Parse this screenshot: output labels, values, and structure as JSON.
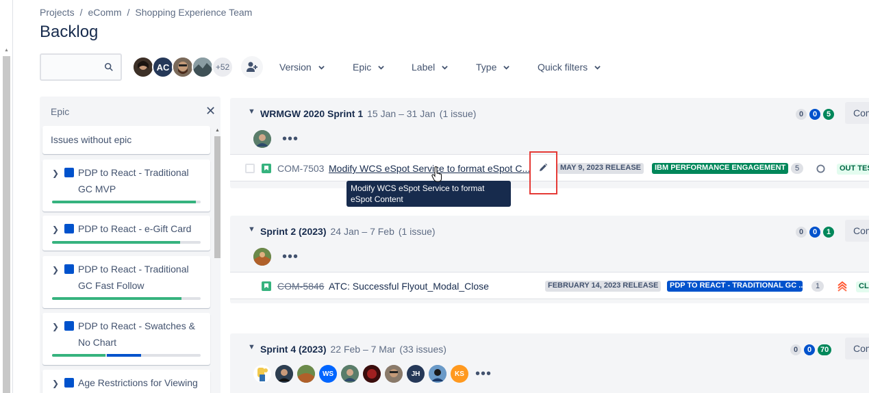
{
  "breadcrumb": {
    "items": [
      "Projects",
      "eComm",
      "Shopping Experience Team"
    ],
    "separator": "/"
  },
  "page_title": "Backlog",
  "search": {
    "value": "",
    "placeholder": ""
  },
  "avatars": {
    "initials": [
      "AC"
    ],
    "more_label": "+52"
  },
  "filters": [
    "Version",
    "Epic",
    "Label",
    "Type",
    "Quick filters"
  ],
  "epic_panel": {
    "header": "Epic",
    "close_glyph": "✕",
    "no_epic_label": "Issues without epic",
    "epics": [
      {
        "name": "PDP to React - Traditional GC MVP",
        "done": 0.97,
        "in_progress": 0
      },
      {
        "name": "PDP to React - e-Gift Card",
        "done": 0.86,
        "in_progress": 0
      },
      {
        "name": "PDP to React - Traditional GC Fast Follow",
        "done": 0.87,
        "in_progress": 0
      },
      {
        "name": "PDP to React - Swatches & No Chart",
        "done": 0.36,
        "in_progress": 0.23
      },
      {
        "name": "Age Restrictions for Viewing",
        "done": 0,
        "in_progress": 0
      }
    ]
  },
  "sprints": [
    {
      "name": "WRMGW 2020 Sprint 1",
      "dates": "15 Jan – 31 Jan",
      "count": "(1 issue)",
      "pills": [
        "0",
        "0",
        "5"
      ],
      "complete_label": "Complete sprint",
      "issue": {
        "key": "COM-7503",
        "summary": "Modify WCS eSpot Service to format eSpot C...",
        "version": "MAY 9, 2023 RELEASE",
        "epic": "IBM PERFORMANCE ENGAGEMENT",
        "epic_color": "#00875a",
        "estimate": "5",
        "status": "OUT TES"
      }
    },
    {
      "name": "Sprint 2 (2023)",
      "dates": "24 Jan – 7 Feb",
      "count": "(1 issue)",
      "pills": [
        "0",
        "0",
        "1"
      ],
      "complete_label": "Complete sprint",
      "issue": {
        "key": "COM-5846",
        "summary": "ATC: Successful Flyout_Modal_Close",
        "version": "FEBRUARY 14, 2023 RELEASE",
        "epic": "PDP TO REACT - TRADITIONAL GC ...",
        "epic_color": "#0052cc",
        "estimate": "1",
        "status": "CL"
      }
    },
    {
      "name": "Sprint 4 (2023)",
      "dates": "22 Feb – 7 Mar",
      "count": "(33 issues)",
      "pills": [
        "0",
        "0",
        "70"
      ],
      "complete_label": "Complete sprint",
      "people_initials": [
        "WS",
        "JH",
        "KS"
      ]
    }
  ],
  "tooltip": "Modify WCS eSpot Service to format eSpot Content",
  "colors": {
    "accent": "#0052cc",
    "done": "#36b37e",
    "highlight": "#e53935",
    "priority_high": "#ff5630"
  }
}
